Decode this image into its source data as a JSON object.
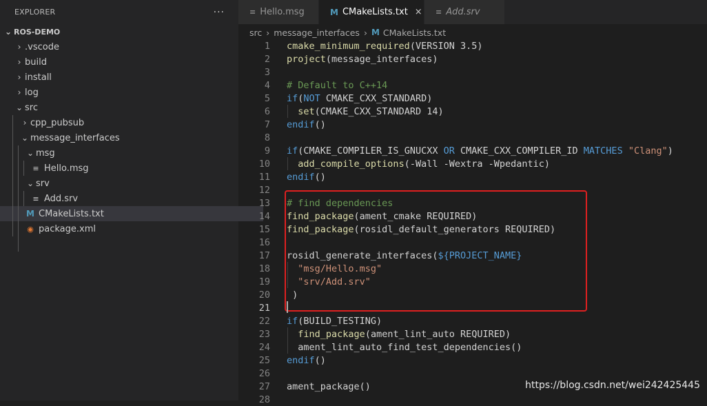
{
  "explorer": {
    "title": "EXPLORER",
    "more": "···",
    "tree": [
      {
        "label": "ROS-DEMO",
        "chev": "⌄",
        "icon": "",
        "depth": 0,
        "root": true,
        "name": "tree-root-ros-demo"
      },
      {
        "label": ".vscode",
        "chev": "›",
        "icon": "",
        "depth": 1,
        "name": "tree-folder-vscode"
      },
      {
        "label": "build",
        "chev": "›",
        "icon": "",
        "depth": 1,
        "name": "tree-folder-build"
      },
      {
        "label": "install",
        "chev": "›",
        "icon": "",
        "depth": 1,
        "name": "tree-folder-install"
      },
      {
        "label": "log",
        "chev": "›",
        "icon": "",
        "depth": 1,
        "name": "tree-folder-log"
      },
      {
        "label": "src",
        "chev": "⌄",
        "icon": "",
        "depth": 1,
        "name": "tree-folder-src"
      },
      {
        "label": "cpp_pubsub",
        "chev": "›",
        "icon": "",
        "depth": 2,
        "name": "tree-folder-cpp-pubsub"
      },
      {
        "label": "message_interfaces",
        "chev": "⌄",
        "icon": "",
        "depth": 2,
        "name": "tree-folder-message-interfaces"
      },
      {
        "label": "msg",
        "chev": "⌄",
        "icon": "",
        "depth": 3,
        "name": "tree-folder-msg"
      },
      {
        "label": "Hello.msg",
        "chev": "",
        "icon": "lines",
        "depth": 4,
        "name": "tree-file-hello-msg"
      },
      {
        "label": "srv",
        "chev": "⌄",
        "icon": "",
        "depth": 3,
        "name": "tree-folder-srv"
      },
      {
        "label": "Add.srv",
        "chev": "",
        "icon": "lines",
        "depth": 4,
        "name": "tree-file-add-srv"
      },
      {
        "label": "CMakeLists.txt",
        "chev": "",
        "icon": "m",
        "depth": 3,
        "selected": true,
        "name": "tree-file-cmakelists"
      },
      {
        "label": "package.xml",
        "chev": "",
        "icon": "rss",
        "depth": 3,
        "name": "tree-file-package-xml"
      }
    ]
  },
  "tabs": [
    {
      "label": "Hello.msg",
      "icon": "lines",
      "active": false,
      "italic": false,
      "name": "tab-hello-msg"
    },
    {
      "label": "CMakeLists.txt",
      "icon": "m",
      "active": true,
      "italic": false,
      "close": "×",
      "name": "tab-cmakelists"
    },
    {
      "label": "Add.srv",
      "icon": "lines",
      "active": false,
      "italic": true,
      "name": "tab-add-srv"
    }
  ],
  "breadcrumb": {
    "parts": [
      "src",
      "message_interfaces"
    ],
    "file": "CMakeLists.txt",
    "sep": "›"
  },
  "editor": {
    "current_line": 21,
    "lines": [
      {
        "n": "1",
        "indent": 0,
        "tokens": [
          [
            "fn",
            "cmake_minimum_required"
          ],
          [
            "",
            "(VERSION 3.5)"
          ]
        ]
      },
      {
        "n": "2",
        "indent": 0,
        "tokens": [
          [
            "fn",
            "project"
          ],
          [
            "",
            "(message_interfaces)"
          ]
        ]
      },
      {
        "n": "3",
        "indent": 0,
        "tokens": []
      },
      {
        "n": "4",
        "indent": 0,
        "tokens": [
          [
            "cm",
            "# Default to C++14"
          ]
        ]
      },
      {
        "n": "5",
        "indent": 0,
        "tokens": [
          [
            "kw",
            "if"
          ],
          [
            "",
            "("
          ],
          [
            "kw",
            "NOT"
          ],
          [
            "",
            " CMAKE_CXX_STANDARD)"
          ]
        ]
      },
      {
        "n": "6",
        "indent": 1,
        "tokens": [
          [
            "",
            ""
          ],
          [
            "fn",
            "set"
          ],
          [
            "",
            "(CMAKE_CXX_STANDARD 14)"
          ]
        ]
      },
      {
        "n": "7",
        "indent": 0,
        "tokens": [
          [
            "kw",
            "endif"
          ],
          [
            "",
            "()"
          ]
        ]
      },
      {
        "n": "8",
        "indent": 0,
        "tokens": []
      },
      {
        "n": "9",
        "indent": 0,
        "tokens": [
          [
            "kw",
            "if"
          ],
          [
            "",
            "(CMAKE_COMPILER_IS_GNUCXX "
          ],
          [
            "kw",
            "OR"
          ],
          [
            "",
            " CMAKE_CXX_COMPILER_ID "
          ],
          [
            "kw",
            "MATCHES"
          ],
          [
            "",
            " "
          ],
          [
            "str",
            "\"Clang\""
          ],
          [
            "",
            ")"
          ]
        ]
      },
      {
        "n": "10",
        "indent": 1,
        "tokens": [
          [
            "fn",
            "add_compile_options"
          ],
          [
            "",
            "(-Wall -Wextra -Wpedantic)"
          ]
        ]
      },
      {
        "n": "11",
        "indent": 0,
        "tokens": [
          [
            "kw",
            "endif"
          ],
          [
            "",
            "()"
          ]
        ]
      },
      {
        "n": "12",
        "indent": 0,
        "tokens": []
      },
      {
        "n": "13",
        "indent": 0,
        "tokens": [
          [
            "cm",
            "# find dependencies"
          ]
        ]
      },
      {
        "n": "14",
        "indent": 0,
        "tokens": [
          [
            "fn",
            "find_package"
          ],
          [
            "",
            "(ament_cmake REQUIRED)"
          ]
        ]
      },
      {
        "n": "15",
        "indent": 0,
        "tokens": [
          [
            "fn",
            "find_package"
          ],
          [
            "",
            "(rosidl_default_generators REQUIRED)"
          ]
        ]
      },
      {
        "n": "16",
        "indent": 0,
        "tokens": []
      },
      {
        "n": "17",
        "indent": 0,
        "tokens": [
          [
            "",
            "rosidl_generate_interfaces("
          ],
          [
            "var",
            "${PROJECT_NAME}"
          ]
        ]
      },
      {
        "n": "18",
        "indent": 1,
        "tokens": [
          [
            "str",
            "\"msg/Hello.msg\""
          ]
        ]
      },
      {
        "n": "19",
        "indent": 1,
        "tokens": [
          [
            "str",
            "\"srv/Add.srv\""
          ]
        ]
      },
      {
        "n": "20",
        "indent": 0,
        "tokens": [
          [
            "",
            " )"
          ]
        ]
      },
      {
        "n": "21",
        "indent": 0,
        "tokens": []
      },
      {
        "n": "22",
        "indent": 0,
        "tokens": [
          [
            "kw",
            "if"
          ],
          [
            "",
            "(BUILD_TESTING)"
          ]
        ]
      },
      {
        "n": "23",
        "indent": 1,
        "tokens": [
          [
            "fn",
            "find_package"
          ],
          [
            "",
            "(ament_lint_auto REQUIRED)"
          ]
        ]
      },
      {
        "n": "24",
        "indent": 1,
        "tokens": [
          [
            "",
            "ament_lint_auto_find_test_dependencies()"
          ]
        ]
      },
      {
        "n": "25",
        "indent": 0,
        "tokens": [
          [
            "kw",
            "endif"
          ],
          [
            "",
            "()"
          ]
        ]
      },
      {
        "n": "26",
        "indent": 0,
        "tokens": []
      },
      {
        "n": "27",
        "indent": 0,
        "tokens": [
          [
            "",
            "ament_package()"
          ]
        ]
      },
      {
        "n": "28",
        "indent": 0,
        "tokens": []
      }
    ]
  },
  "watermark": "https://blog.csdn.net/wei242425445",
  "colors": {
    "keyword": "#569cd6",
    "function": "#dcdcaa",
    "comment": "#6a9955",
    "string": "#ce9178",
    "highlight_box": "#e02020"
  }
}
